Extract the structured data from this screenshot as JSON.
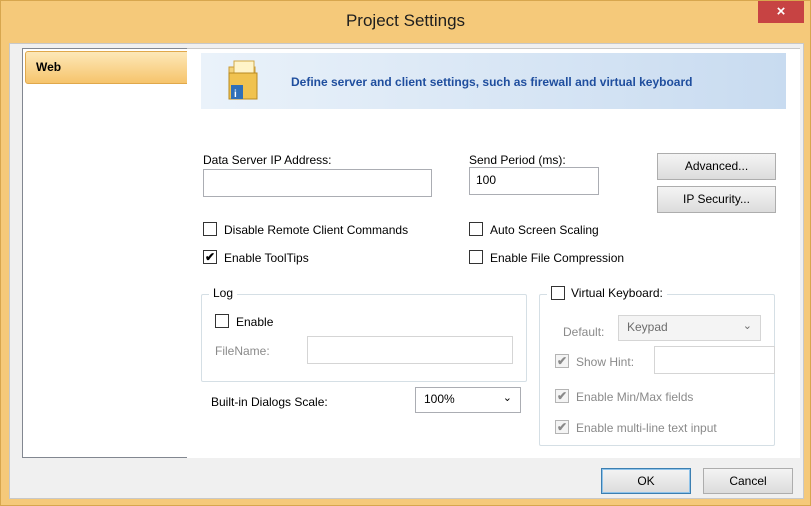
{
  "window": {
    "title": "Project Settings",
    "close_label": "×"
  },
  "sidebar": {
    "items": [
      {
        "label": "Web"
      }
    ]
  },
  "banner": {
    "text": "Define server and  client settings, such as firewall and virtual keyboard"
  },
  "fields": {
    "data_server_label": "Data Server IP Address:",
    "data_server_value": "",
    "send_period_label": "Send Period (ms):",
    "send_period_value": "100"
  },
  "buttons": {
    "advanced": "Advanced...",
    "ip_security": "IP Security...",
    "ok": "OK",
    "cancel": "Cancel"
  },
  "checkboxes": {
    "disable_remote": {
      "label": "Disable Remote Client Commands",
      "checked": false
    },
    "enable_tooltips": {
      "label": "Enable ToolTips",
      "checked": true
    },
    "auto_scaling": {
      "label": "Auto Screen Scaling",
      "checked": false
    },
    "file_compression": {
      "label": "Enable File Compression",
      "checked": false
    }
  },
  "log": {
    "title": "Log",
    "enable_label": "Enable",
    "filename_label": "FileName:",
    "filename_value": ""
  },
  "dialogs_scale": {
    "label": "Built-in Dialogs Scale:",
    "value": "100%"
  },
  "virtual_keyboard": {
    "label": "Virtual Keyboard:",
    "default_label": "Default:",
    "default_value": "Keypad",
    "show_hint_label": "Show Hint:",
    "show_hint_value": "",
    "min_max_label": "Enable Min/Max fields",
    "multiline_label": "Enable multi-line text input"
  },
  "check_glyph": "✔",
  "chevron_glyph": "⌄"
}
